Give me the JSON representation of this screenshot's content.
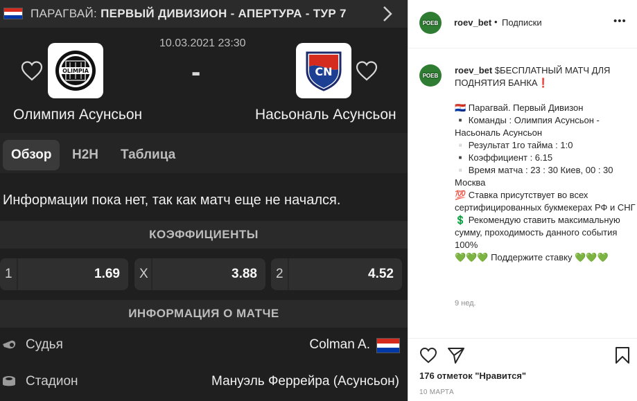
{
  "match": {
    "league_prefix": "ПАРАГВАЙ: ",
    "league_title": "ПЕРВЫЙ ДИВИЗИОН - АПЕРТУРА - ТУР 7",
    "datetime": "10.03.2021 23:30",
    "score": "-",
    "home_team": "Олимпия Асунсьон",
    "home_logo_text": "OLIMPIA",
    "away_team": "Насьональ Асунсьон",
    "away_logo_text": "CN",
    "tabs": [
      {
        "label": "Обзор",
        "active": true
      },
      {
        "label": "H2H",
        "active": false
      },
      {
        "label": "Таблица",
        "active": false
      }
    ],
    "info_text": "Информации пока нет, так как матч еще не начался.",
    "odds_header": "КОЭФФИЦИЕНТЫ",
    "odds": [
      {
        "label": "1",
        "value": "1.69"
      },
      {
        "label": "X",
        "value": "3.88"
      },
      {
        "label": "2",
        "value": "4.52"
      }
    ],
    "match_info_header": "ИНФОРМАЦИЯ О МАТЧЕ",
    "referee_label": "Судья",
    "referee_value": "Colman A.",
    "stadium_label": "Стадион",
    "stadium_value": "Мануэль Феррейра (Асунсьон)"
  },
  "post": {
    "username": "roev_bet",
    "follow_label": "Подписки",
    "dot": "•",
    "avatar_text": "РОЕВ",
    "caption_lines": [
      "$БЕСПЛАТНЫЙ МАТЧ ДЛЯ ПОДНЯТИЯ БАНКА❗",
      "",
      "🇵🇾 Парагвай. Первый Дивизон",
      "▪️ Команды : Олимпия Асунсьон - Насьональ Асунсьон",
      "▫️ Результат 1го тайма : 1:0",
      "▪️ Коэффициент : 6.15",
      "▫️ Время матча : 23 : 30 Киев, 00 : 30 Москва",
      "💯 Ставка присутствует во всех сертифицированных букмекерах РФ и СНГ",
      "💲 Рекомендую ставить максимальную сумму, проходимость данного события 100%",
      "💚💚💚 Поддержите ставку 💚💚💚"
    ],
    "time_ago": "9 нед.",
    "likes": "176 отметок \"Нравится\"",
    "date": "10 МАРТА"
  },
  "colors": {
    "dark_bg": "#1f1f1f",
    "flag_red": "#d52b1e",
    "flag_blue": "#0038a8",
    "insta_text": "#262626",
    "insta_muted": "#8e8e8e"
  }
}
